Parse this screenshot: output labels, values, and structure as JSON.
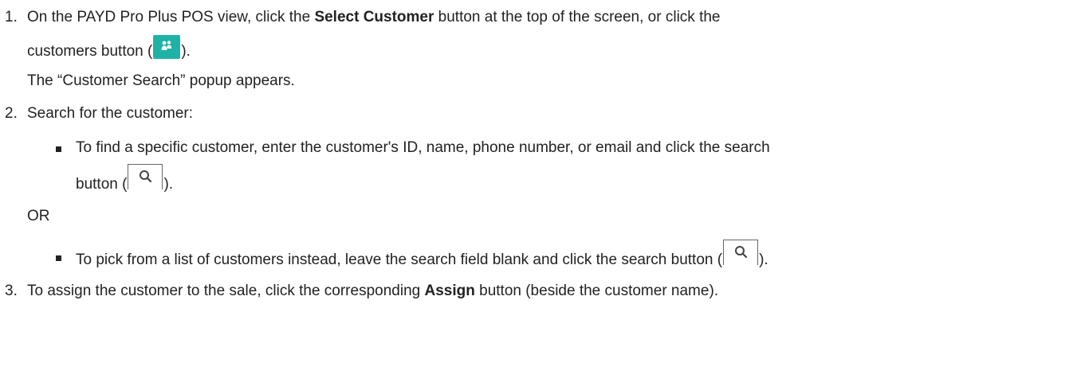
{
  "steps": [
    {
      "number": "1.",
      "text_before": "On the PAYD Pro Plus POS view, click the ",
      "bold": "Select Customer",
      "text_after": " button at the top of the screen, or click the",
      "line2_before": "customers button (",
      "line2_after": ").",
      "note": "The “Customer Search” popup appears."
    },
    {
      "number": "2.",
      "text": "Search for the customer:",
      "bullet1_line1": "To find a specific customer, enter the customer's ID, name, phone number, or email and click the search",
      "bullet1_line2_before": "button (",
      "bullet1_line2_after": ").",
      "or_text": "OR",
      "bullet2_before": "To pick from a list of customers instead, leave the search field blank and click the search button (",
      "bullet2_after": ")."
    },
    {
      "number": "3.",
      "text_before": "To assign the customer to the sale, click the corresponding ",
      "bold": "Assign",
      "text_after": " button (beside the customer name)."
    }
  ],
  "icons": {
    "customers_icon": "customers-icon",
    "search_icon": "search-icon",
    "customers_icon_color": "#1fb3a8"
  }
}
